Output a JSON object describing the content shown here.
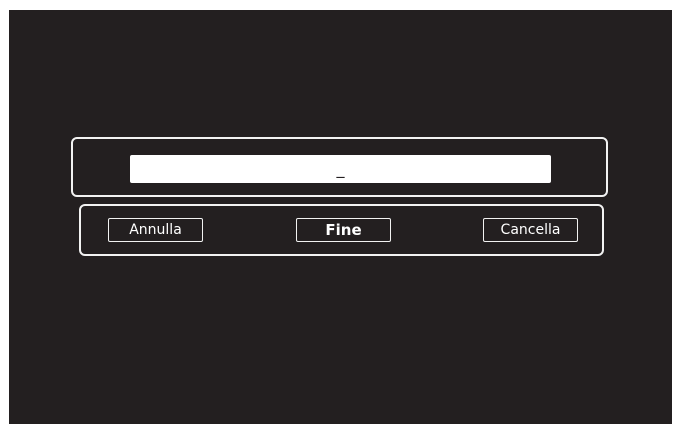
{
  "dialog": {
    "input_value": "_"
  },
  "buttons": {
    "cancel_label": "Annulla",
    "done_label": "Fine",
    "delete_label": "Cancella"
  }
}
